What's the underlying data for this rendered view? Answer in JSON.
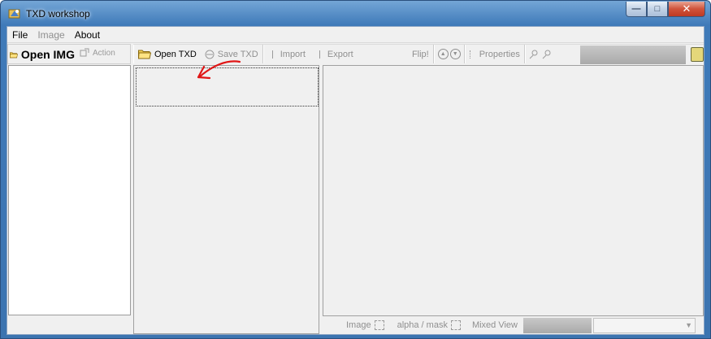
{
  "window": {
    "title": "TXD workshop",
    "controls": {
      "minimize": "—",
      "maximize": "□",
      "close": "✕"
    }
  },
  "menu": {
    "items": [
      {
        "label": "File",
        "enabled": true
      },
      {
        "label": "Image",
        "enabled": false
      },
      {
        "label": "About",
        "enabled": true
      }
    ]
  },
  "left_panel": {
    "open_img_label": "Open IMG",
    "action_label": "Action"
  },
  "toolbar": {
    "open_txd": "Open TXD",
    "save_txd": "Save TXD",
    "import": "Import",
    "export": "Export",
    "flip": "Flip!",
    "properties": "Properties"
  },
  "bottom_bar": {
    "image": "Image",
    "alpha_mask": "alpha / mask",
    "mixed_view": "Mixed View"
  },
  "colors": {
    "title_gradient_top": "#74a6d6",
    "annotation_red": "#e01616",
    "client_bg": "#f0f0f0"
  }
}
